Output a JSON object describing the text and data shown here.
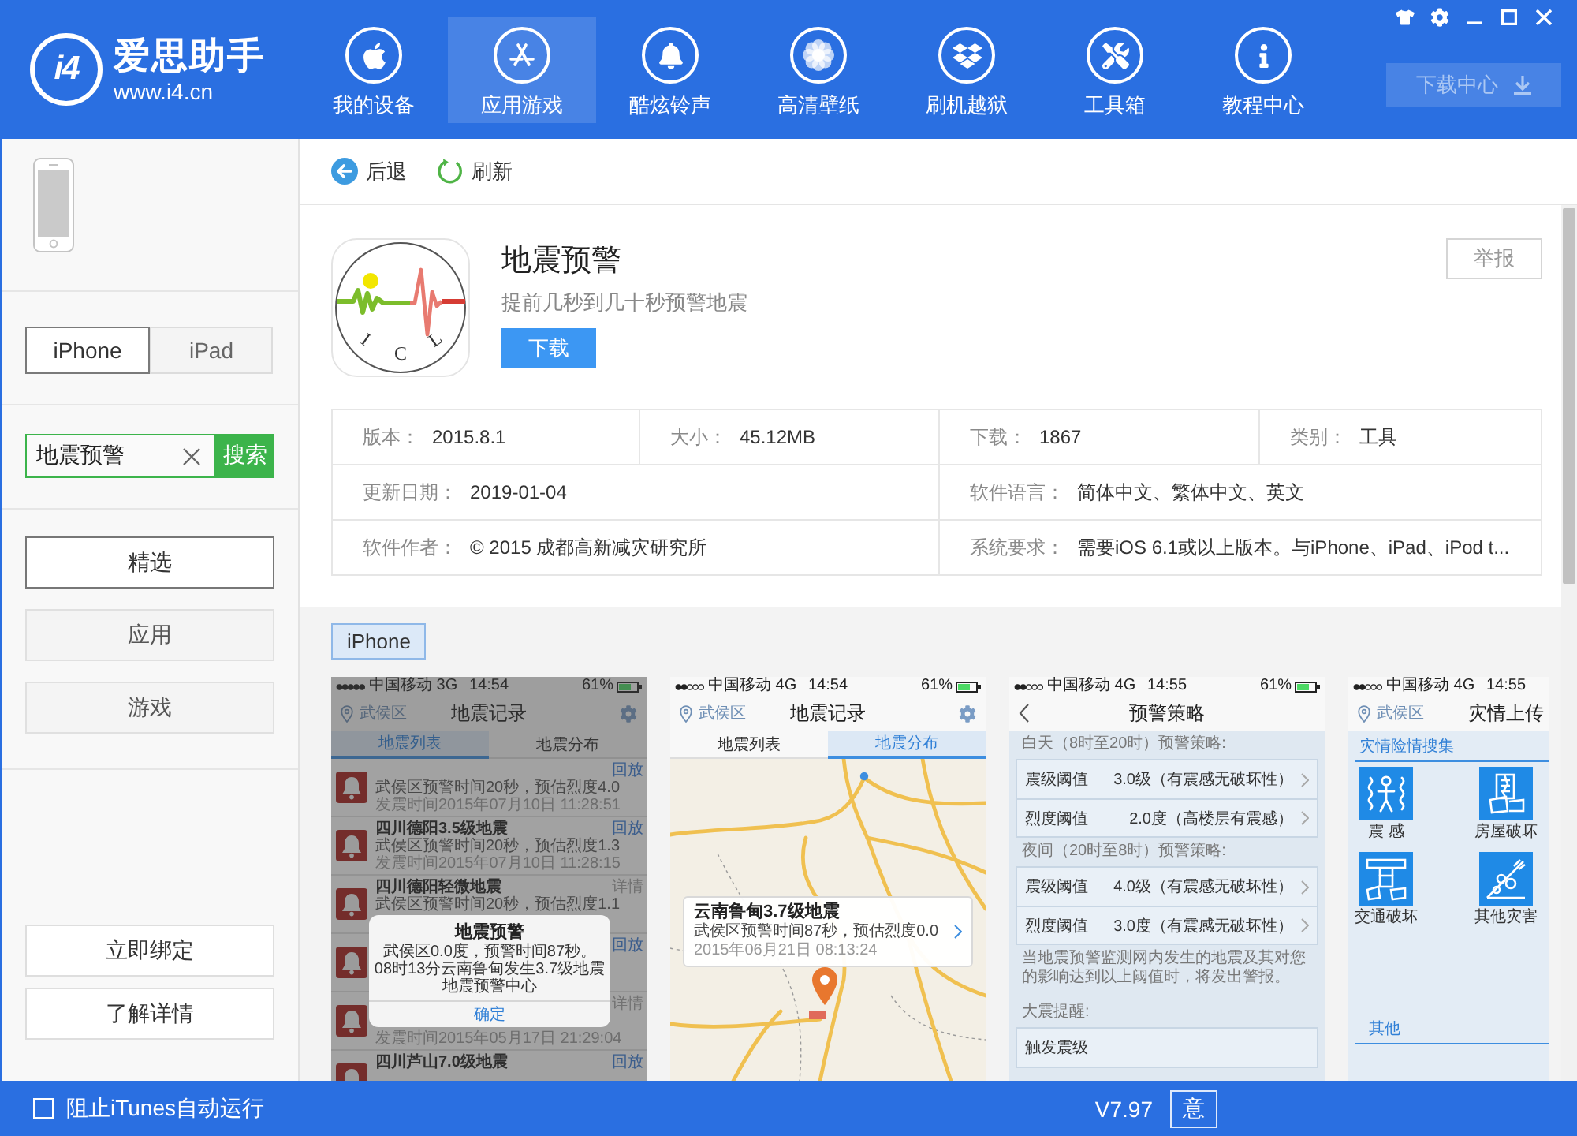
{
  "header": {
    "logo": {
      "mark": "i4",
      "name": "爱思助手",
      "url": "www.i4.cn"
    },
    "nav": [
      {
        "label": "我的设备",
        "selected": false
      },
      {
        "label": "应用游戏",
        "selected": true
      },
      {
        "label": "酷炫铃声",
        "selected": false
      },
      {
        "label": "高清壁纸",
        "selected": false
      },
      {
        "label": "刷机越狱",
        "selected": false
      },
      {
        "label": "工具箱",
        "selected": false
      },
      {
        "label": "教程中心",
        "selected": false
      }
    ],
    "download_center": "下载中心"
  },
  "sidebar": {
    "device_tabs": [
      {
        "label": "iPhone",
        "selected": true
      },
      {
        "label": "iPad",
        "selected": false
      }
    ],
    "search": {
      "value": "地震预警",
      "button": "搜索"
    },
    "categories": [
      {
        "label": "精选",
        "selected": true
      },
      {
        "label": "应用",
        "selected": false
      },
      {
        "label": "游戏",
        "selected": false
      }
    ],
    "actions": [
      "立即绑定",
      "了解详情"
    ]
  },
  "toolbar": [
    {
      "label": "后退"
    },
    {
      "label": "刷新"
    }
  ],
  "app": {
    "icon_letters": [
      "I",
      "C",
      "L"
    ],
    "title": "地震预警",
    "subtitle": "提前几秒到几十秒预警地震",
    "download": "下载",
    "report": "举报",
    "info": [
      [
        {
          "label": "版本：",
          "value": "2015.8.1"
        },
        {
          "label": "大小：",
          "value": "45.12MB"
        },
        {
          "label": "下载：",
          "value": "1867"
        },
        {
          "label": "类别：",
          "value": "工具"
        }
      ],
      [
        {
          "label": "更新日期：",
          "value": "2019-01-04"
        },
        {
          "label": "软件语言：",
          "value": "简体中文、繁体中文、英文"
        }
      ],
      [
        {
          "label": "软件作者：",
          "value": "© 2015 成都高新减灾研究所"
        },
        {
          "label": "系统要求：",
          "value": "需要iOS 6.1或以上版本。与iPhone、iPad、iPod t..."
        }
      ]
    ]
  },
  "screenshots": {
    "device_tab": {
      "label": "iPhone",
      "selected": true
    },
    "shots": [
      {
        "kind": "list",
        "status": {
          "carrier": "中国移动 3G",
          "time": "14:54",
          "battery": "61%"
        },
        "nav": {
          "location": "武侯区",
          "title": "地震记录"
        },
        "tabs": [
          {
            "label": "地震列表",
            "selected": true
          },
          {
            "label": "地震分布",
            "selected": false
          }
        ],
        "rows": [
          {
            "kind": "replay",
            "desc": "武侯区预警时间20秒，预估烈度4.0",
            "time": "发震时间2015年07月10日 11:28:51",
            "action": "回放"
          },
          {
            "kind": "replay",
            "title": "四川德阳3.5级地震",
            "desc": "武侯区预警时间20秒，预估烈度1.3",
            "time": "发震时间2015年07月10日 11:28:15",
            "action": "回放"
          },
          {
            "kind": "details",
            "title": "四川德阳轻微地震",
            "desc": "武侯区预警时间20秒，预估烈度1.1",
            "action": "详情"
          },
          {
            "kind": "replay",
            "action": "回放"
          },
          {
            "kind": "details",
            "time": "发震时间2015年05月17日 21:29:04",
            "action": "详情"
          },
          {
            "kind": "replay",
            "title": "四川芦山7.0级地震",
            "action": "回放"
          }
        ],
        "dialog": {
          "title": "地震预警",
          "lines": [
            "武侯区0.0度，预警时间87秒。",
            "08时13分云南鲁甸发生3.7级地震",
            "地震预警中心"
          ],
          "button": "确定"
        }
      },
      {
        "kind": "map",
        "status": {
          "carrier": "中国移动 4G",
          "time": "14:54",
          "battery": "61%"
        },
        "nav": {
          "location": "武侯区",
          "title": "地震记录"
        },
        "tabs": [
          {
            "label": "地震列表",
            "selected": false
          },
          {
            "label": "地震分布",
            "selected": true
          }
        ],
        "card": {
          "title": "云南鲁甸3.7级地震",
          "desc": "武侯区预警时间87秒，预估烈度0.0",
          "time": "2015年06月21日 08:13:24"
        }
      },
      {
        "kind": "settings",
        "status": {
          "carrier": "中国移动 4G",
          "time": "14:55",
          "battery": "61%"
        },
        "nav": {
          "title": "预警策略"
        },
        "sections": [
          {
            "heading": "白天（8时至20时）预警策略:",
            "rows": [
              {
                "label": "震级阈值",
                "value": "3.0级（有震感无破坏性）"
              },
              {
                "label": "烈度阈值",
                "value": "2.0度（高楼层有震感）"
              }
            ]
          },
          {
            "heading": "夜间（20时至8时）预警策略:",
            "rows": [
              {
                "label": "震级阈值",
                "value": "4.0级（有震感无破坏性）"
              },
              {
                "label": "烈度阈值",
                "value": "3.0度（有震感无破坏性）"
              }
            ],
            "note": "当地震预警监测网内发生的地震及其对您的影响达到以上阈值时，将发出警报。"
          },
          {
            "heading": "大震提醒:",
            "rows": [
              {
                "label": "触发震级"
              }
            ]
          }
        ]
      },
      {
        "kind": "tiles",
        "status": {
          "carrier": "中国移动 4G",
          "time": "14:55"
        },
        "nav": {
          "location": "武侯区",
          "title": "灾情上传"
        },
        "section": "灾情险情搜集",
        "tiles": [
          "震 感",
          "房屋破坏",
          "交通破坏",
          "其他灾害"
        ],
        "footer": "其他"
      }
    ]
  },
  "status_bar": {
    "itunes": {
      "label": "阻止iTunes自动运行",
      "checked": false
    },
    "version": "V7.97",
    "button": "意"
  }
}
